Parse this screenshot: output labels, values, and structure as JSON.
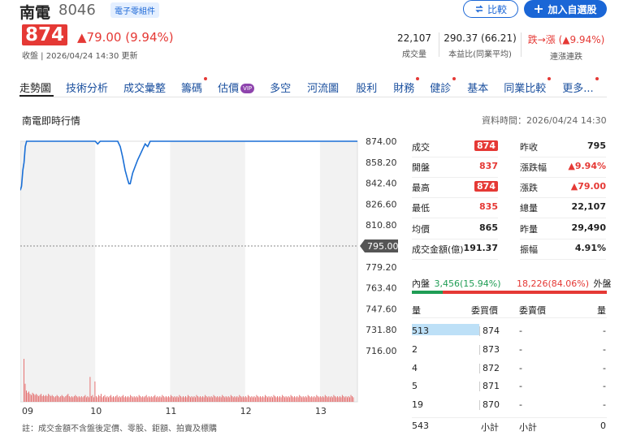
{
  "header": {
    "stock_name": "南電",
    "stock_code": "8046",
    "sector_badge": "電子零組件",
    "compare_label": "比較",
    "watchlist_label": "加入自選股",
    "price": "874",
    "change": "▲79.00 (9.94%)",
    "close_info": "收盤 | 2026/04/24 14:30 更新"
  },
  "kpis": [
    {
      "value": "22,107",
      "label": "成交量"
    },
    {
      "value": "290.37 (66.21)",
      "label": "本益比(同業平均)"
    },
    {
      "value": "跌→漲 (▲9.94%)",
      "label": "連漲連跌"
    }
  ],
  "tabs": [
    {
      "label": "走勢圖",
      "dot": false,
      "vip": false
    },
    {
      "label": "技術分析",
      "dot": false,
      "vip": false
    },
    {
      "label": "成交彙整",
      "dot": false,
      "vip": false
    },
    {
      "label": "籌碼",
      "dot": true,
      "vip": false
    },
    {
      "label": "估價",
      "dot": false,
      "vip": true
    },
    {
      "label": "多空",
      "dot": false,
      "vip": false
    },
    {
      "label": "河流圖",
      "dot": false,
      "vip": false
    },
    {
      "label": "股利",
      "dot": false,
      "vip": false
    },
    {
      "label": "財務",
      "dot": true,
      "vip": false
    },
    {
      "label": "健診",
      "dot": true,
      "vip": false
    },
    {
      "label": "基本",
      "dot": false,
      "vip": false
    },
    {
      "label": "同業比較",
      "dot": true,
      "vip": false
    },
    {
      "label": "更多",
      "dot": true,
      "vip": false
    }
  ],
  "vip_label": "VIP",
  "section": {
    "title": "南電即時行情",
    "data_time": "資料時間：2026/04/24 14:30"
  },
  "chart_data": {
    "type": "line",
    "y_ticks": [
      "874.00",
      "858.20",
      "842.40",
      "826.60",
      "810.80",
      "795.00",
      "779.20",
      "763.40",
      "747.60",
      "731.80",
      "716.00"
    ],
    "y_values": [
      874.0,
      858.2,
      842.4,
      826.6,
      810.8,
      795.0,
      779.2,
      763.4,
      747.6,
      731.8,
      716.0
    ],
    "ylim": [
      716.0,
      874.0
    ],
    "reference_price": 795.0,
    "reference_label": "795.00",
    "x_ticks": [
      "09",
      "10",
      "11",
      "12",
      "13"
    ],
    "x_tick_minutes": [
      0,
      60,
      120,
      180,
      240
    ],
    "x_range_minutes": [
      0,
      270
    ],
    "series": [
      {
        "x": [
          0,
          1,
          2,
          3,
          4,
          5,
          8,
          15,
          30,
          60,
          62,
          64,
          66,
          70,
          78,
          80,
          82,
          84,
          86,
          87,
          88,
          89,
          90,
          92,
          94,
          96,
          98,
          100,
          102,
          104,
          106,
          110,
          120,
          150,
          180,
          210,
          240,
          270
        ],
        "y": [
          837,
          840,
          852,
          858,
          870,
          874,
          874,
          874,
          874,
          874,
          872,
          874,
          874,
          874,
          874,
          870,
          862,
          852,
          845,
          842,
          842,
          846,
          850,
          855,
          860,
          864,
          868,
          872,
          870,
          874,
          874,
          874,
          874,
          874,
          874,
          874,
          874,
          874
        ]
      }
    ],
    "volume": [
      38,
      16,
      10,
      8,
      9,
      7,
      6,
      8,
      7,
      6,
      7,
      6,
      5,
      6,
      7,
      5,
      6,
      5,
      6,
      5,
      7,
      6,
      5,
      6,
      5,
      4,
      5,
      6,
      5,
      4,
      5,
      6,
      5,
      4,
      5,
      6,
      7,
      5,
      4,
      5,
      4,
      5,
      6,
      5,
      4,
      5,
      4,
      5,
      4,
      5,
      6,
      4,
      5,
      4,
      22,
      5,
      6,
      4,
      18,
      5,
      4,
      6,
      5,
      7,
      4,
      5,
      6,
      4,
      5,
      4,
      5,
      6,
      4,
      5,
      4,
      5,
      6,
      4,
      5,
      4,
      5,
      6,
      4,
      5,
      4,
      5,
      4,
      6,
      5,
      4,
      5,
      4,
      5,
      4,
      6,
      5,
      4,
      5,
      4,
      5,
      6,
      4,
      5,
      4,
      5,
      4,
      5,
      6,
      4,
      5,
      4,
      5,
      4,
      6,
      5,
      4,
      5,
      4,
      5,
      4,
      6,
      5,
      4,
      5,
      4,
      5,
      4,
      6,
      5,
      4,
      5,
      4,
      5,
      4,
      6,
      5,
      4,
      5,
      4,
      5,
      4,
      6,
      5,
      4,
      5,
      4,
      5,
      4,
      6,
      5,
      4,
      5,
      4,
      5,
      4,
      6,
      5,
      4,
      5,
      4,
      5,
      4,
      6,
      5,
      4,
      5,
      4,
      5,
      4,
      6,
      5,
      4,
      5,
      4,
      5,
      4,
      6,
      5,
      4,
      5,
      4,
      5,
      4,
      6,
      5,
      4,
      5,
      4,
      5,
      4,
      6,
      5,
      4,
      5,
      4,
      5,
      4,
      6,
      5,
      4,
      5,
      4,
      5,
      4,
      6,
      5,
      4,
      5,
      4,
      5,
      4,
      6,
      5,
      4,
      5,
      4,
      5,
      4,
      6,
      5,
      4,
      5,
      4,
      5,
      4,
      6,
      5,
      4,
      5,
      4,
      5,
      4,
      6,
      5,
      4,
      5,
      4,
      5,
      4,
      6,
      5,
      4,
      5,
      4,
      5,
      4,
      6,
      5,
      4,
      5,
      4,
      5,
      4,
      6,
      5,
      4,
      5,
      4,
      5,
      4,
      6,
      5,
      4,
      5,
      4,
      5,
      4,
      6,
      5,
      4
    ],
    "grid": true,
    "colors": {
      "line": "#1a6fd6",
      "volume": "#e57373",
      "shade": "#f2f2f2",
      "reference": "#888888"
    }
  },
  "quote": {
    "left": [
      {
        "label": "成交",
        "value": "874",
        "style": "badge"
      },
      {
        "label": "開盤",
        "value": "837",
        "style": "red"
      },
      {
        "label": "最高",
        "value": "874",
        "style": "badge"
      },
      {
        "label": "最低",
        "value": "835",
        "style": "red"
      },
      {
        "label": "均價",
        "value": "865",
        "style": "plain"
      },
      {
        "label": "成交金額(億)",
        "value": "191.37",
        "style": "plain"
      }
    ],
    "right": [
      {
        "label": "昨收",
        "value": "795",
        "style": "plain"
      },
      {
        "label": "漲跌幅",
        "value": "▲9.94%",
        "style": "red"
      },
      {
        "label": "漲跌",
        "value": "▲79.00",
        "style": "red"
      },
      {
        "label": "總量",
        "value": "22,107",
        "style": "plain"
      },
      {
        "label": "昨量",
        "value": "29,490",
        "style": "plain"
      },
      {
        "label": "振幅",
        "value": "4.91%",
        "style": "plain"
      }
    ]
  },
  "inout": {
    "inner_label": "內盤",
    "inner_value": "3,456(15.94%)",
    "outer_value": "18,226(84.06%)",
    "outer_label": "外盤",
    "inner_fraction": 0.1594
  },
  "orderbook": {
    "headers": [
      "量",
      "委買價",
      "委賣價",
      "量"
    ],
    "rows": [
      {
        "bid_vol": "513",
        "bid_price": "874",
        "ask_price": "-",
        "ask_vol": "-"
      },
      {
        "bid_vol": "2",
        "bid_price": "873",
        "ask_price": "-",
        "ask_vol": "-"
      },
      {
        "bid_vol": "4",
        "bid_price": "872",
        "ask_price": "-",
        "ask_vol": "-"
      },
      {
        "bid_vol": "5",
        "bid_price": "871",
        "ask_price": "-",
        "ask_vol": "-"
      },
      {
        "bid_vol": "19",
        "bid_price": "870",
        "ask_price": "-",
        "ask_vol": "-"
      }
    ],
    "total": {
      "bid_vol": "543",
      "bid_label": "小計",
      "ask_label": "小計",
      "ask_vol": "0"
    }
  },
  "note": "註：成交金額不含盤後定價、零股、鉅額、拍賣及標購"
}
